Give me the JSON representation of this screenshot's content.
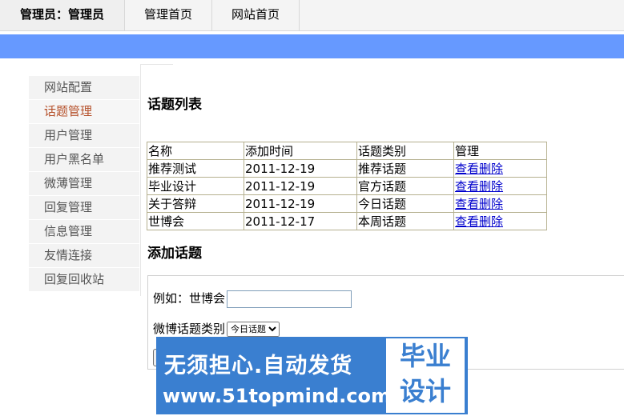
{
  "header": {
    "admin_label": "管理员：管理员",
    "admin_home": "管理首页",
    "site_home": "网站首页"
  },
  "sidebar": {
    "items": [
      {
        "label": "网站配置"
      },
      {
        "label": "话题管理",
        "active": true
      },
      {
        "label": "用户管理"
      },
      {
        "label": "用户黑名单"
      },
      {
        "label": "微薄管理"
      },
      {
        "label": "回复管理"
      },
      {
        "label": "信息管理"
      },
      {
        "label": "友情连接"
      },
      {
        "label": "回复回收站"
      }
    ]
  },
  "list": {
    "title": "话题列表",
    "columns": [
      "名称",
      "添加时间",
      "话题类别",
      "管理"
    ],
    "rows": [
      {
        "name": "推荐测试",
        "date": "2011-12-19",
        "category": "推荐话题",
        "action": "查看删除"
      },
      {
        "name": "毕业设计",
        "date": "2011-12-19",
        "category": "官方话题",
        "action": "查看删除"
      },
      {
        "name": "关于答辩",
        "date": "2011-12-19",
        "category": "今日话题",
        "action": "查看删除"
      },
      {
        "name": "世博会",
        "date": "2011-12-17",
        "category": "本周话题",
        "action": "查看删除"
      }
    ]
  },
  "add": {
    "title": "添加话题",
    "example_label": "例如：世博会",
    "name_value": "",
    "category_label": "微博话题类别",
    "category_selected": "今日话题"
  },
  "banner": {
    "line1": "无须担心.自动发货",
    "line2": "www.51topmind.com",
    "right_top": "毕业",
    "right_bottom": "设计"
  },
  "colors": {
    "accent_bar": "#6699ff",
    "active_nav": "#b5502a",
    "link": "#0000cc",
    "banner_blue": "#3a7fd0"
  }
}
